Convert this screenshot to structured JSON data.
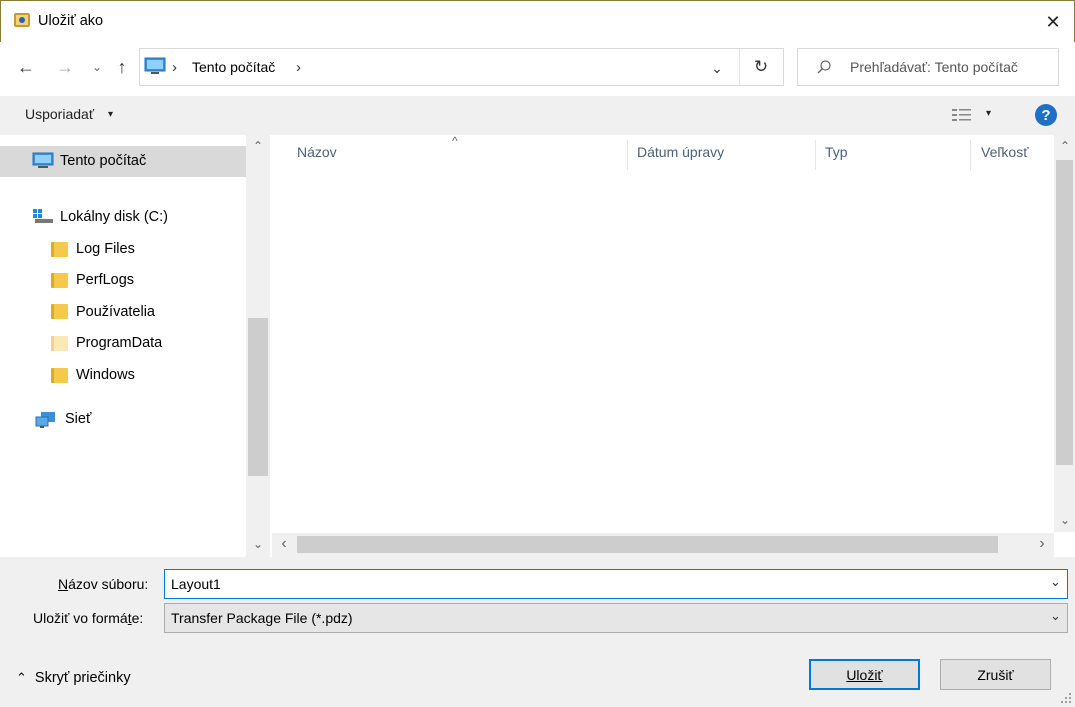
{
  "window": {
    "title": "Uložiť ako",
    "close_glyph": "✕"
  },
  "nav": {
    "back_glyph": "←",
    "forward_glyph": "→",
    "recent_glyph": "⌄",
    "up_glyph": "↑",
    "address_path": [
      "Tento počítač"
    ],
    "address_sep": "›",
    "address_drop_glyph": "⌄",
    "refresh_glyph": "↻",
    "search_placeholder": "Prehľadávať: Tento počítač"
  },
  "toolbar": {
    "organize_label": "Usporiadať",
    "caret": "▾",
    "help_label": "?"
  },
  "sidebar": {
    "items": [
      {
        "label": "Tento počítač",
        "icon": "computer-icon",
        "selected": true
      },
      {
        "label": "Lokálny disk (C:)",
        "icon": "drive-icon"
      },
      {
        "label": "Log Files",
        "icon": "folder-icon"
      },
      {
        "label": "PerfLogs",
        "icon": "folder-icon"
      },
      {
        "label": "Používatelia",
        "icon": "folder-icon"
      },
      {
        "label": "ProgramData",
        "icon": "folder-icon"
      },
      {
        "label": "Windows",
        "icon": "folder-icon"
      },
      {
        "label": "Sieť",
        "icon": "network-icon"
      }
    ],
    "scroll_up": "⌃",
    "scroll_down": "⌄"
  },
  "filelist": {
    "columns": [
      "Názov",
      "Dátum úpravy",
      "Typ",
      "Veľkosť"
    ],
    "sort_glyph": "^",
    "scroll_left": "‹",
    "scroll_right": "›",
    "scroll_up": "⌃",
    "scroll_down": "⌄"
  },
  "form": {
    "filename_label_u": "N",
    "filename_label_rest": "ázov súboru:",
    "filename_value": "Layout1",
    "format_label_pre": "Uložiť vo formá",
    "format_label_u": "t",
    "format_label_post": "e:",
    "format_value": "Transfer Package File (*.pdz)",
    "combo_glyph": "⌄"
  },
  "footer": {
    "hide_folders_glyph": "⌃",
    "hide_folders_label": "Skryť priečinky",
    "save_label": "Uložiť",
    "cancel_label": "Zrušiť"
  },
  "colors": {
    "accent": "#0078d7",
    "help": "#1f6fc5",
    "folder": "#f6c94d",
    "selected_bg": "#d9d9d9",
    "chrome_bg": "#f0f0f0"
  }
}
